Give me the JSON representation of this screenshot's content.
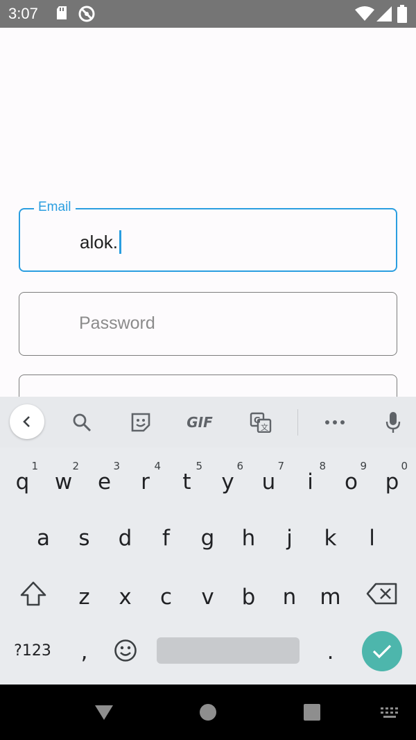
{
  "status_bar": {
    "time": "3:07",
    "left_icons": [
      "sd-card-icon",
      "do-not-disturb-icon"
    ],
    "right_icons": [
      "wifi-icon",
      "cell-signal-icon",
      "battery-icon"
    ]
  },
  "form": {
    "email": {
      "label": "Email",
      "value": "alok.",
      "focused": true
    },
    "password": {
      "placeholder": "Password"
    }
  },
  "keyboard": {
    "toolbar": {
      "items": [
        "back-icon",
        "search-icon",
        "sticker-icon",
        "gif",
        "translate-icon",
        "more-icon",
        "mic-icon"
      ],
      "gif_label": "GIF"
    },
    "row1": [
      {
        "letter": "q",
        "hint": "1"
      },
      {
        "letter": "w",
        "hint": "2"
      },
      {
        "letter": "e",
        "hint": "3"
      },
      {
        "letter": "r",
        "hint": "4"
      },
      {
        "letter": "t",
        "hint": "5"
      },
      {
        "letter": "y",
        "hint": "6"
      },
      {
        "letter": "u",
        "hint": "7"
      },
      {
        "letter": "i",
        "hint": "8"
      },
      {
        "letter": "o",
        "hint": "9"
      },
      {
        "letter": "p",
        "hint": "0"
      }
    ],
    "row2": [
      "a",
      "s",
      "d",
      "f",
      "g",
      "h",
      "j",
      "k",
      "l"
    ],
    "row3": [
      "z",
      "x",
      "c",
      "v",
      "b",
      "n",
      "m"
    ],
    "row4": {
      "symbols_label": "?123",
      "comma": ",",
      "period": "."
    },
    "accent_color": "#4db6ac"
  },
  "nav_bar": {
    "buttons": [
      "back-triangle-icon",
      "home-circle-icon",
      "recents-square-icon",
      "keyboard-switch-icon"
    ]
  }
}
